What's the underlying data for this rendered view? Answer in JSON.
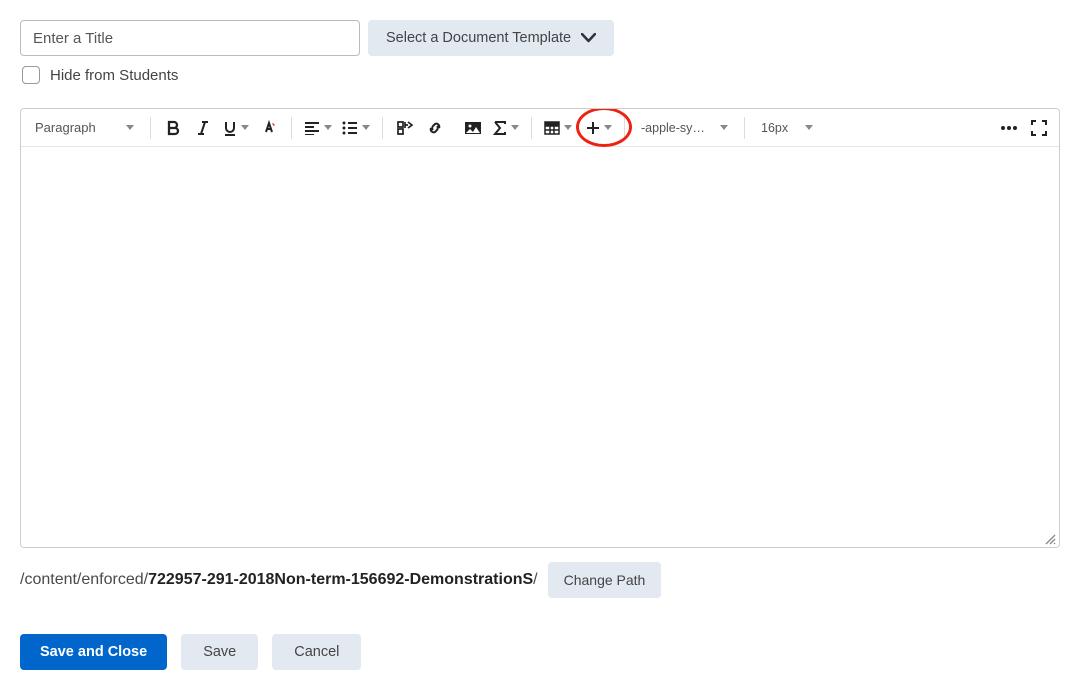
{
  "header": {
    "title_placeholder": "Enter a Title",
    "template_button": "Select a Document Template",
    "hide_checkbox_label": "Hide from Students"
  },
  "toolbar": {
    "paragraph_label": "Paragraph",
    "font_family": "-apple-syste…",
    "font_size": "16px"
  },
  "path": {
    "prefix": "/content/enforced/",
    "folder": "722957-291-2018Non-term-156692-DemonstrationS",
    "suffix": "/",
    "change_button": "Change Path"
  },
  "actions": {
    "save_close": "Save and Close",
    "save": "Save",
    "cancel": "Cancel"
  }
}
